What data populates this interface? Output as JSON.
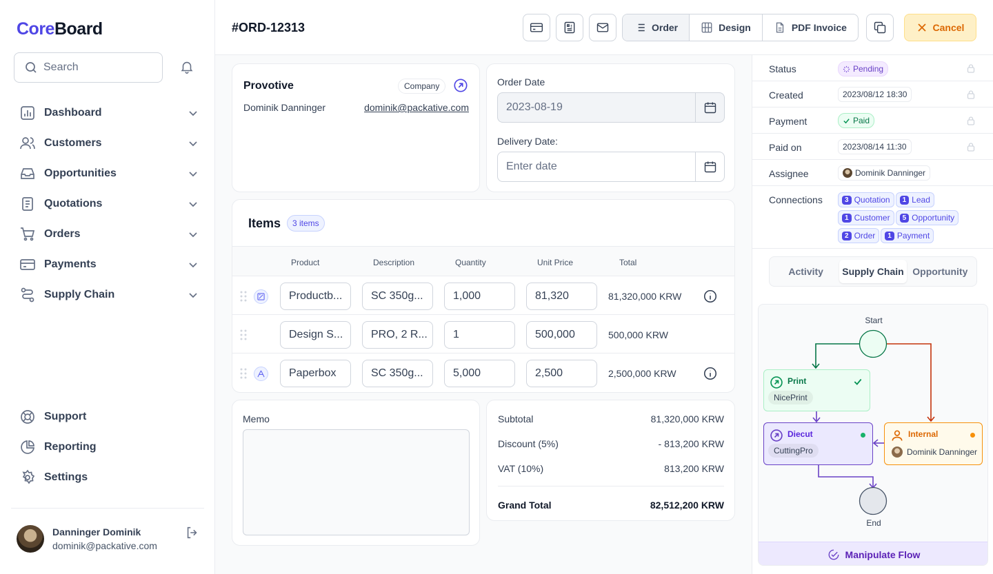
{
  "app": {
    "logo_core": "Core",
    "logo_board": "Board"
  },
  "search": {
    "placeholder": "Search"
  },
  "sidebar": {
    "items": [
      {
        "label": "Dashboard"
      },
      {
        "label": "Customers"
      },
      {
        "label": "Opportunities"
      },
      {
        "label": "Quotations"
      },
      {
        "label": "Orders"
      },
      {
        "label": "Payments"
      },
      {
        "label": "Supply Chain"
      }
    ],
    "bottom": [
      {
        "label": "Support"
      },
      {
        "label": "Reporting"
      },
      {
        "label": "Settings"
      }
    ],
    "user": {
      "name": "Danninger Dominik",
      "email": "dominik@packative.com"
    }
  },
  "header": {
    "order_id": "#ORD-12313",
    "views": [
      {
        "label": "Order"
      },
      {
        "label": "Design"
      },
      {
        "label": "PDF Invoice"
      }
    ],
    "cancel_label": "Cancel"
  },
  "customer": {
    "company": "Provotive",
    "badge": "Company",
    "contact": "Dominik Danninger",
    "email": "dominik@packative.com"
  },
  "dates": {
    "order_label": "Order Date",
    "order_value": "2023-08-19",
    "delivery_label": "Delivery Date:",
    "delivery_placeholder": "Enter date"
  },
  "items": {
    "title": "Items",
    "count_badge": "3 items",
    "columns": [
      "Product",
      "Description",
      "Quantity",
      "Unit Price",
      "Total"
    ],
    "rows": [
      {
        "product": "Productb...",
        "description": "SC 350g...",
        "quantity": "1,000",
        "unit_price": "81,320",
        "total": "81,320,000 KRW"
      },
      {
        "product": "Design S...",
        "description": "PRO, 2 R...",
        "quantity": "1",
        "unit_price": "500,000",
        "total": "500,000 KRW"
      },
      {
        "product": "Paperbox",
        "description": "SC 350g...",
        "quantity": "5,000",
        "unit_price": "2,500",
        "total": "2,500,000 KRW"
      }
    ]
  },
  "memo": {
    "label": "Memo"
  },
  "summary": {
    "subtotal_label": "Subtotal",
    "subtotal": "81,320,000 KRW",
    "discount_label": "Discount (5%)",
    "discount": "- 813,200 KRW",
    "vat_label": "VAT (10%)",
    "vat": "813,200 KRW",
    "grand_label": "Grand Total",
    "grand": "82,512,200 KRW"
  },
  "properties": {
    "status_label": "Status",
    "status": "Pending",
    "created_label": "Created",
    "created": "2023/08/12 18:30",
    "payment_label": "Payment",
    "payment": "Paid",
    "paid_on_label": "Paid on",
    "paid_on": "2023/08/14 11:30",
    "assignee_label": "Assignee",
    "assignee": "Dominik Danninger",
    "connections_label": "Connections",
    "connections": [
      {
        "count": "3",
        "label": "Quotation"
      },
      {
        "count": "1",
        "label": "Lead"
      },
      {
        "count": "1",
        "label": "Customer"
      },
      {
        "count": "5",
        "label": "Opportunity"
      },
      {
        "count": "2",
        "label": "Order"
      },
      {
        "count": "1",
        "label": "Payment"
      }
    ]
  },
  "tabs": [
    {
      "label": "Activity"
    },
    {
      "label": "Supply Chain"
    },
    {
      "label": "Opportunity"
    }
  ],
  "flow": {
    "start": "Start",
    "end": "End",
    "print": {
      "title": "Print",
      "vendor": "NicePrint"
    },
    "diecut": {
      "title": "Diecut",
      "vendor": "CuttingPro"
    },
    "internal": {
      "title": "Internal",
      "person": "Dominik Danninger"
    },
    "action": "Manipulate Flow"
  },
  "colors": {
    "accent": "#4f46e5",
    "warning": "#dc6803",
    "success": "#079455"
  }
}
